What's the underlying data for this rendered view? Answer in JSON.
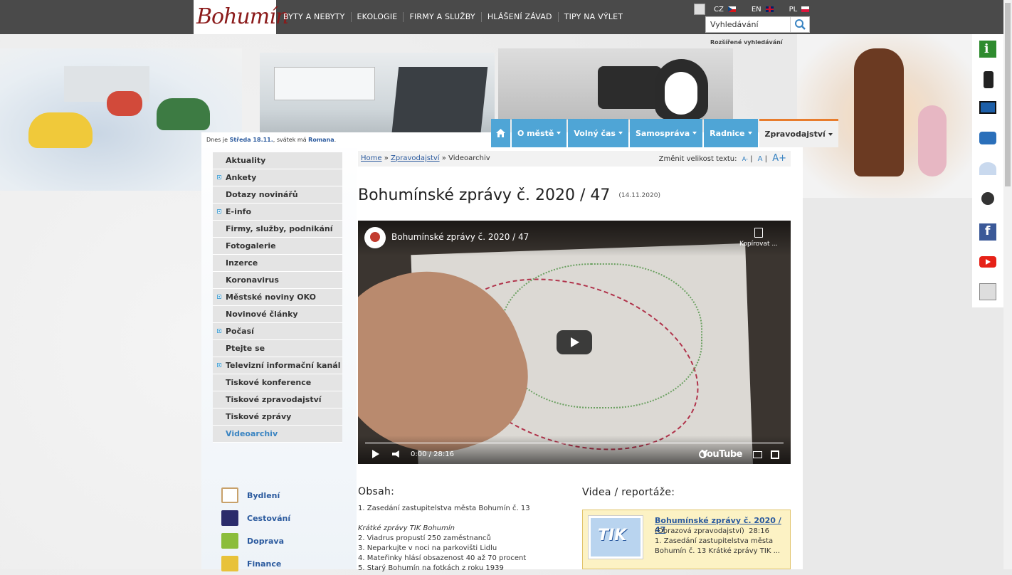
{
  "top": {
    "logo": "Bohumín",
    "nav": [
      "BYTY A NEBYTY",
      "EKOLOGIE",
      "FIRMY A SLUŽBY",
      "HLÁŠENÍ ZÁVAD",
      "TIPY NA VÝLET"
    ],
    "languages": [
      "CZ",
      "EN",
      "PL"
    ],
    "search_value": "Vyhledávání",
    "advanced_search": "Rozšířené vyhledávání"
  },
  "date_line": {
    "prefix": "Dnes je",
    "date": "Středa 18.11.",
    "middle": ", svátek má",
    "name": "Romana",
    "suffix": "."
  },
  "main_nav": [
    {
      "label": "O městě"
    },
    {
      "label": "Volný čas"
    },
    {
      "label": "Samospráva"
    },
    {
      "label": "Radnice"
    },
    {
      "label": "Zpravodajství"
    }
  ],
  "sidebar": [
    {
      "label": "Aktuality",
      "expand": false
    },
    {
      "label": "Ankety",
      "expand": true
    },
    {
      "label": "Dotazy novinářů",
      "expand": false
    },
    {
      "label": "E-info",
      "expand": true
    },
    {
      "label": "Firmy, služby, podnikání",
      "expand": false
    },
    {
      "label": "Fotogalerie",
      "expand": false
    },
    {
      "label": "Inzerce",
      "expand": false
    },
    {
      "label": "Koronavirus",
      "expand": false
    },
    {
      "label": "Městské noviny OKO",
      "expand": true
    },
    {
      "label": "Novinové články",
      "expand": false
    },
    {
      "label": "Počasí",
      "expand": true
    },
    {
      "label": "Ptejte se",
      "expand": false
    },
    {
      "label": "Televizní informační kanál",
      "expand": true
    },
    {
      "label": "Tiskové konference",
      "expand": false
    },
    {
      "label": "Tiskové zpravodajství",
      "expand": false
    },
    {
      "label": "Tiskové zprávy",
      "expand": false
    },
    {
      "label": "Videoarchiv",
      "expand": false,
      "current": true
    }
  ],
  "categories": [
    "Bydlení",
    "Cestování",
    "Doprava",
    "Finance"
  ],
  "breadcrumb": {
    "home": "Home",
    "sep": "»",
    "section": "Zpravodajství",
    "current": "Videoarchiv",
    "size_label": "Změnit velikost textu:",
    "size_small": "A-",
    "size_normal": "A",
    "size_large": "A+"
  },
  "article": {
    "title": "Bohumínské zprávy č. 2020 / 47",
    "date": "(14.11.2020)"
  },
  "video": {
    "title": "Bohumínské zprávy č. 2020 / 47",
    "copy_label": "Kopírovat ...",
    "time": "0:00 / 28:16",
    "brand": "YouTube"
  },
  "obsah": {
    "heading": "Obsah:",
    "line1": "1. Zasedání zastupitelstva města Bohumín č. 13",
    "subheading": "Krátké zprávy TIK Bohumín",
    "items": [
      "2. Viadrus propustí 250 zaměstnanců",
      "3. Neparkujte v noci na parkovišti Lidlu",
      "4. Mateřinky hlásí obsazenost 40 až 70 procent",
      "5. Starý Bohumín na fotkách z roku 1939"
    ]
  },
  "videa": {
    "heading": "Videa / reportáže:",
    "card_title": "Bohumínské zprávy č. 2020 / 47",
    "card_category": "(Obrazová zpravodajství)",
    "card_duration": "28:16",
    "card_excerpt": "1. Zasedání zastupitelstva města Bohumín č. 13 Krátké zprávy TIK ...",
    "thumb_logo": "TIK"
  }
}
